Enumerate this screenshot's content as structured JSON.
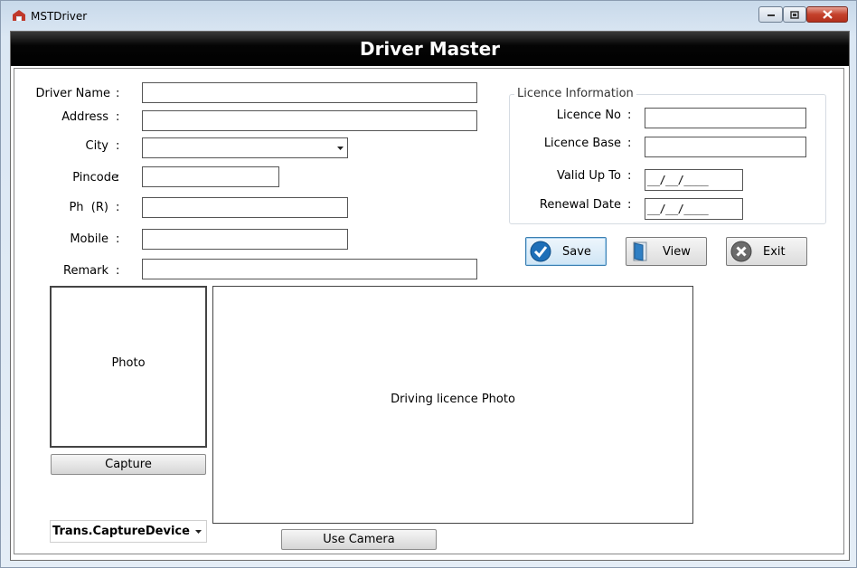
{
  "window": {
    "title": "MSTDriver"
  },
  "header": {
    "title": "Driver Master"
  },
  "form": {
    "colon": ":",
    "driver_name_label": "Driver Name",
    "address_label": "Address",
    "city_label": "City",
    "pincode_label": "Pincode",
    "phone_label": "Ph  (R)",
    "mobile_label": "Mobile",
    "remark_label": "Remark",
    "driver_name_value": "",
    "address_value": "",
    "city_value": "",
    "pincode_value": "",
    "phone_value": "",
    "mobile_value": "",
    "remark_value": ""
  },
  "licence": {
    "group_title": "Licence Information",
    "licence_no_label": "Licence No",
    "licence_base_label": "Licence Base",
    "valid_up_to_label": "Valid Up To",
    "renewal_date_label": "Renewal Date",
    "licence_no_value": "",
    "licence_base_value": "",
    "valid_up_to_value": "__/__/____",
    "renewal_date_value": "__/__/____"
  },
  "actions": {
    "save_label": "Save",
    "view_label": "View",
    "exit_label": "Exit"
  },
  "photos": {
    "photo_label": "Photo",
    "licence_photo_label": "Driving licence Photo",
    "capture_label": "Capture",
    "use_camera_label": "Use Camera",
    "capture_device_value": "Trans.CaptureDevice"
  },
  "colors": {
    "header_bg": "#000000",
    "save_accent": "#1e6fb8",
    "exit_icon": "#6b6b6b",
    "close_button": "#c4402b"
  }
}
